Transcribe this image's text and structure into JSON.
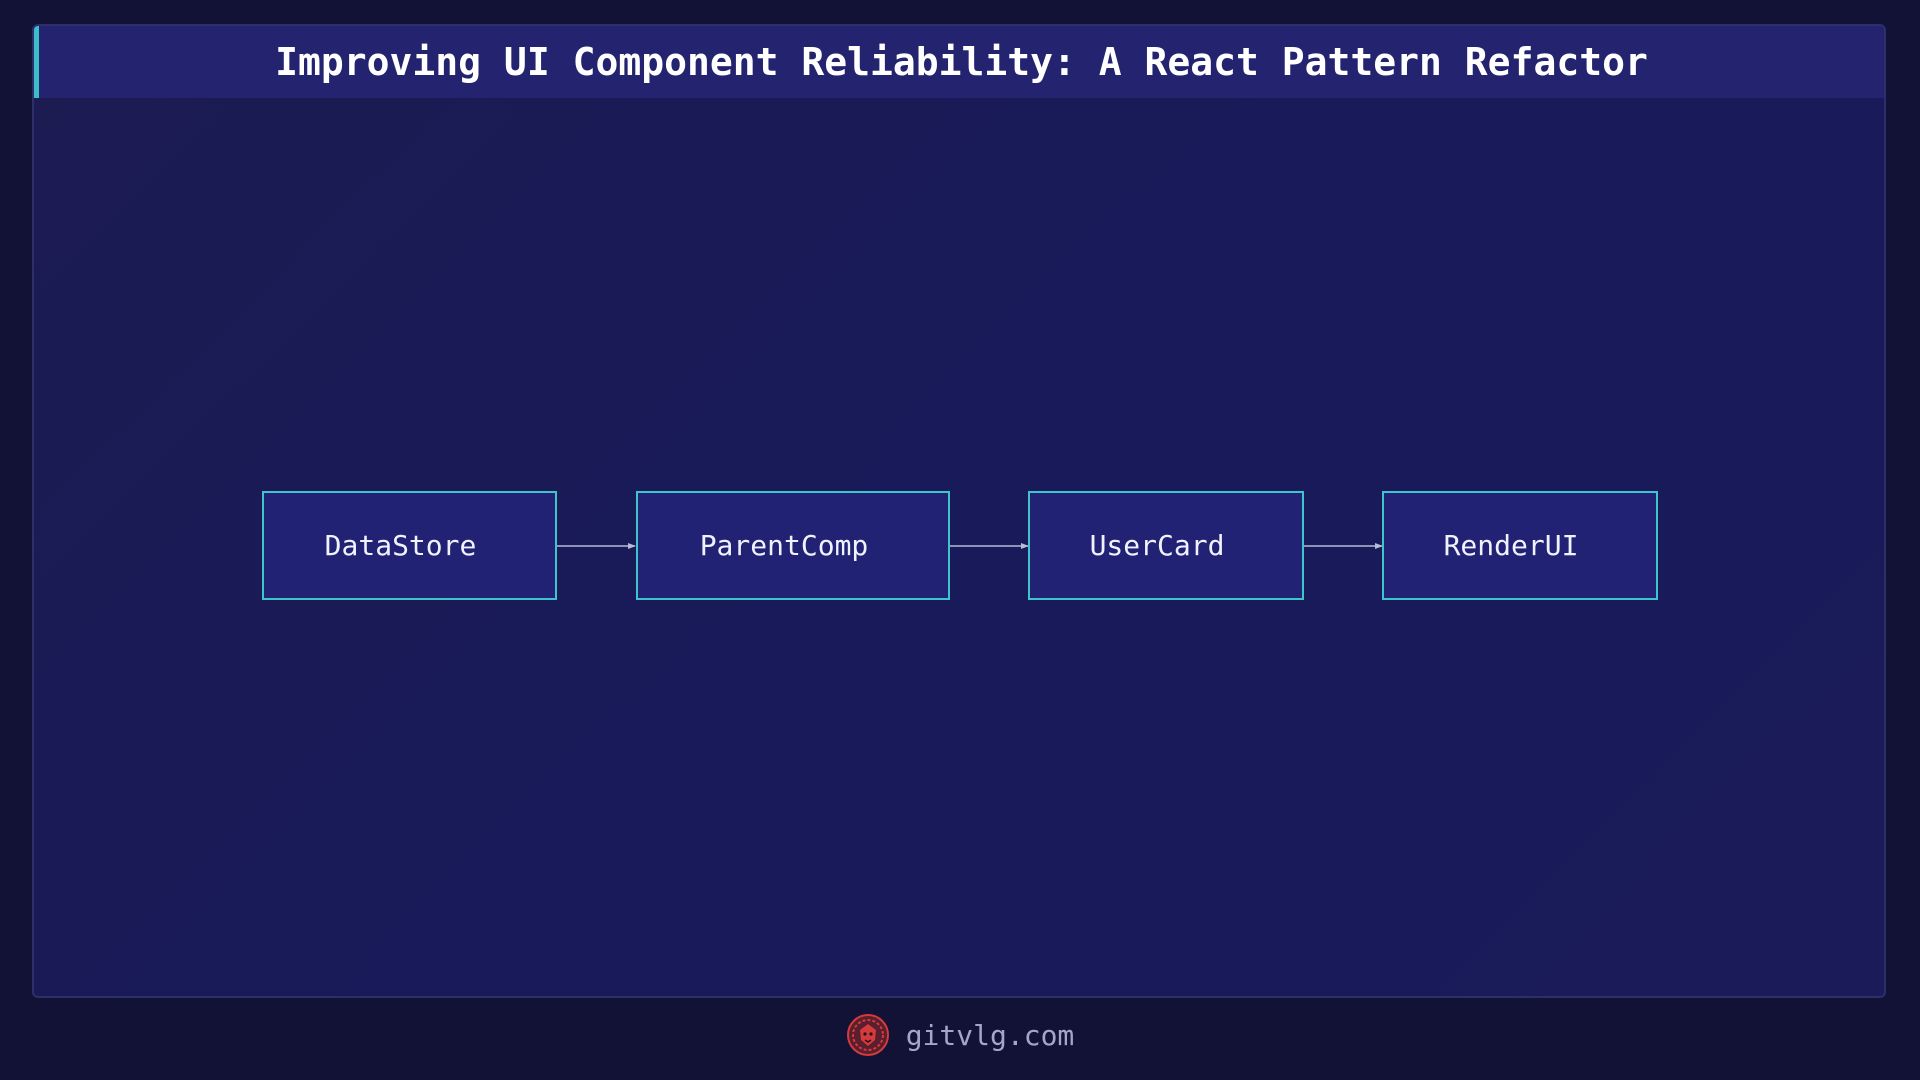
{
  "header": {
    "title": "Improving UI Component Reliability: A React Pattern Refactor"
  },
  "diagram": {
    "nodes": [
      {
        "id": "datastore",
        "label": "DataStore"
      },
      {
        "id": "parentcomp",
        "label": "ParentComp"
      },
      {
        "id": "usercard",
        "label": "UserCard"
      },
      {
        "id": "renderui",
        "label": "RenderUI"
      }
    ],
    "edges": [
      {
        "from": "datastore",
        "to": "parentcomp"
      },
      {
        "from": "parentcomp",
        "to": "usercard"
      },
      {
        "from": "usercard",
        "to": "renderui"
      }
    ]
  },
  "footer": {
    "site": "gitvlg.com",
    "logo_icon": "lion-head-icon"
  },
  "colors": {
    "background": "#111236",
    "panel": "#1b1b56",
    "title_bar": "#23236f",
    "accent": "#3dbdc9",
    "node_fill": "#222274",
    "node_border": "#3fc4cc",
    "edge": "#b8bbd6",
    "logo": "#d43b3b"
  }
}
